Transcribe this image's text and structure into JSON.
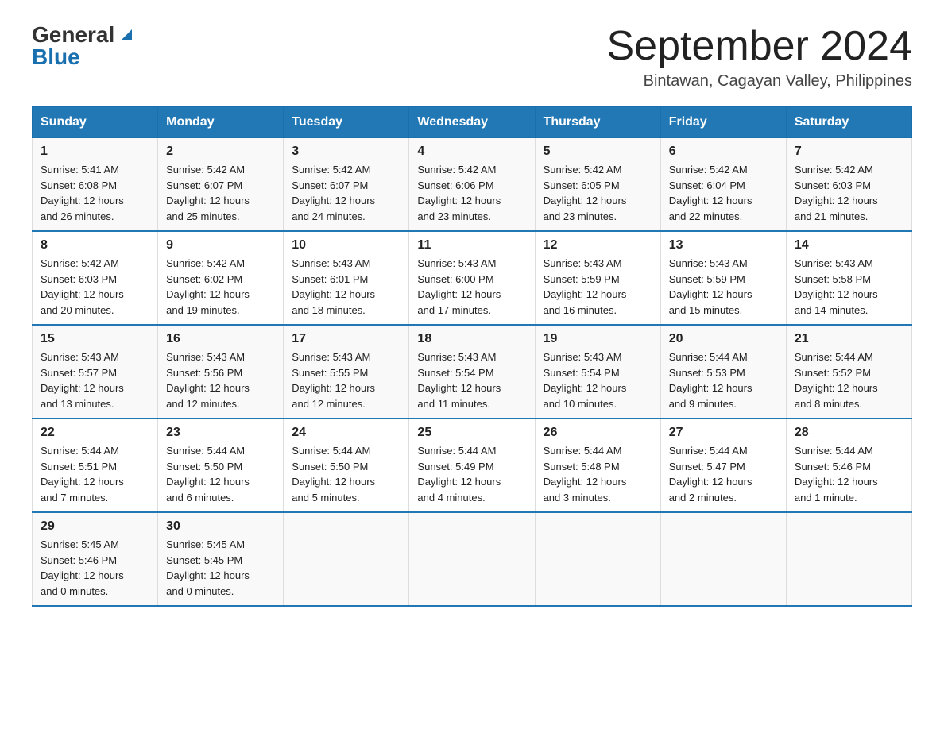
{
  "header": {
    "logo_general": "General",
    "logo_blue": "Blue",
    "month_title": "September 2024",
    "location": "Bintawan, Cagayan Valley, Philippines"
  },
  "days_of_week": [
    "Sunday",
    "Monday",
    "Tuesday",
    "Wednesday",
    "Thursday",
    "Friday",
    "Saturday"
  ],
  "weeks": [
    [
      {
        "day": "1",
        "sunrise": "5:41 AM",
        "sunset": "6:08 PM",
        "daylight": "12 hours and 26 minutes."
      },
      {
        "day": "2",
        "sunrise": "5:42 AM",
        "sunset": "6:07 PM",
        "daylight": "12 hours and 25 minutes."
      },
      {
        "day": "3",
        "sunrise": "5:42 AM",
        "sunset": "6:07 PM",
        "daylight": "12 hours and 24 minutes."
      },
      {
        "day": "4",
        "sunrise": "5:42 AM",
        "sunset": "6:06 PM",
        "daylight": "12 hours and 23 minutes."
      },
      {
        "day": "5",
        "sunrise": "5:42 AM",
        "sunset": "6:05 PM",
        "daylight": "12 hours and 23 minutes."
      },
      {
        "day": "6",
        "sunrise": "5:42 AM",
        "sunset": "6:04 PM",
        "daylight": "12 hours and 22 minutes."
      },
      {
        "day": "7",
        "sunrise": "5:42 AM",
        "sunset": "6:03 PM",
        "daylight": "12 hours and 21 minutes."
      }
    ],
    [
      {
        "day": "8",
        "sunrise": "5:42 AM",
        "sunset": "6:03 PM",
        "daylight": "12 hours and 20 minutes."
      },
      {
        "day": "9",
        "sunrise": "5:42 AM",
        "sunset": "6:02 PM",
        "daylight": "12 hours and 19 minutes."
      },
      {
        "day": "10",
        "sunrise": "5:43 AM",
        "sunset": "6:01 PM",
        "daylight": "12 hours and 18 minutes."
      },
      {
        "day": "11",
        "sunrise": "5:43 AM",
        "sunset": "6:00 PM",
        "daylight": "12 hours and 17 minutes."
      },
      {
        "day": "12",
        "sunrise": "5:43 AM",
        "sunset": "5:59 PM",
        "daylight": "12 hours and 16 minutes."
      },
      {
        "day": "13",
        "sunrise": "5:43 AM",
        "sunset": "5:59 PM",
        "daylight": "12 hours and 15 minutes."
      },
      {
        "day": "14",
        "sunrise": "5:43 AM",
        "sunset": "5:58 PM",
        "daylight": "12 hours and 14 minutes."
      }
    ],
    [
      {
        "day": "15",
        "sunrise": "5:43 AM",
        "sunset": "5:57 PM",
        "daylight": "12 hours and 13 minutes."
      },
      {
        "day": "16",
        "sunrise": "5:43 AM",
        "sunset": "5:56 PM",
        "daylight": "12 hours and 12 minutes."
      },
      {
        "day": "17",
        "sunrise": "5:43 AM",
        "sunset": "5:55 PM",
        "daylight": "12 hours and 12 minutes."
      },
      {
        "day": "18",
        "sunrise": "5:43 AM",
        "sunset": "5:54 PM",
        "daylight": "12 hours and 11 minutes."
      },
      {
        "day": "19",
        "sunrise": "5:43 AM",
        "sunset": "5:54 PM",
        "daylight": "12 hours and 10 minutes."
      },
      {
        "day": "20",
        "sunrise": "5:44 AM",
        "sunset": "5:53 PM",
        "daylight": "12 hours and 9 minutes."
      },
      {
        "day": "21",
        "sunrise": "5:44 AM",
        "sunset": "5:52 PM",
        "daylight": "12 hours and 8 minutes."
      }
    ],
    [
      {
        "day": "22",
        "sunrise": "5:44 AM",
        "sunset": "5:51 PM",
        "daylight": "12 hours and 7 minutes."
      },
      {
        "day": "23",
        "sunrise": "5:44 AM",
        "sunset": "5:50 PM",
        "daylight": "12 hours and 6 minutes."
      },
      {
        "day": "24",
        "sunrise": "5:44 AM",
        "sunset": "5:50 PM",
        "daylight": "12 hours and 5 minutes."
      },
      {
        "day": "25",
        "sunrise": "5:44 AM",
        "sunset": "5:49 PM",
        "daylight": "12 hours and 4 minutes."
      },
      {
        "day": "26",
        "sunrise": "5:44 AM",
        "sunset": "5:48 PM",
        "daylight": "12 hours and 3 minutes."
      },
      {
        "day": "27",
        "sunrise": "5:44 AM",
        "sunset": "5:47 PM",
        "daylight": "12 hours and 2 minutes."
      },
      {
        "day": "28",
        "sunrise": "5:44 AM",
        "sunset": "5:46 PM",
        "daylight": "12 hours and 1 minute."
      }
    ],
    [
      {
        "day": "29",
        "sunrise": "5:45 AM",
        "sunset": "5:46 PM",
        "daylight": "12 hours and 0 minutes."
      },
      {
        "day": "30",
        "sunrise": "5:45 AM",
        "sunset": "5:45 PM",
        "daylight": "12 hours and 0 minutes."
      },
      null,
      null,
      null,
      null,
      null
    ]
  ],
  "labels": {
    "sunrise": "Sunrise:",
    "sunset": "Sunset:",
    "daylight": "Daylight:"
  }
}
